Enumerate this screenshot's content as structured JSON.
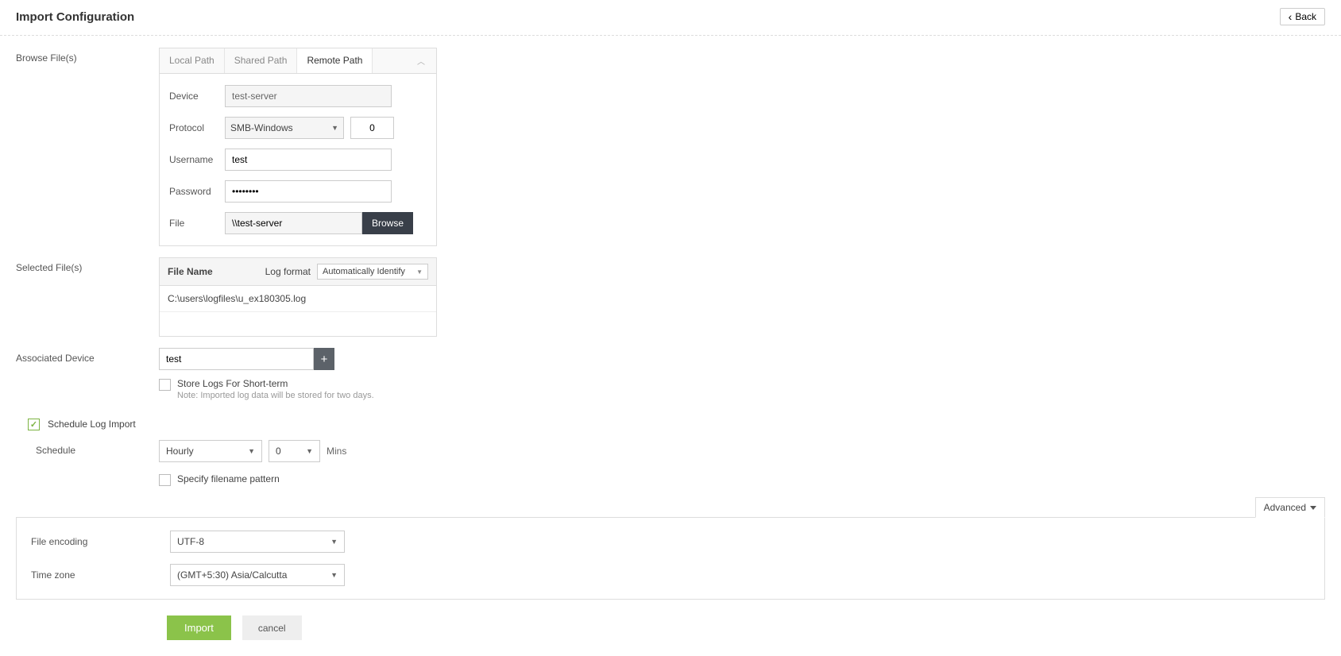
{
  "header": {
    "title": "Import Configuration",
    "back": "Back"
  },
  "labels": {
    "browseFiles": "Browse File(s)",
    "selectedFiles": "Selected File(s)",
    "associatedDevice": "Associated Device",
    "schedule": "Schedule",
    "fileEncoding": "File encoding",
    "timeZone": "Time zone"
  },
  "tabs": {
    "local": "Local Path",
    "shared": "Shared Path",
    "remote": "Remote Path"
  },
  "fields": {
    "device": {
      "label": "Device",
      "value": "test-server"
    },
    "protocol": {
      "label": "Protocol",
      "value": "SMB-Windows",
      "port": "0"
    },
    "username": {
      "label": "Username",
      "value": "test"
    },
    "password": {
      "label": "Password",
      "value": "••••••••"
    },
    "file": {
      "label": "File",
      "value": "\\\\test-server",
      "browse": "Browse"
    }
  },
  "selectedFiles": {
    "header": {
      "fileName": "File Name",
      "logFormat": "Log format",
      "formatValue": "Automatically Identify"
    },
    "files": [
      "C:\\users\\logfiles\\u_ex180305.log"
    ]
  },
  "associatedDevice": {
    "value": "test",
    "storeLogs": {
      "label": "Store Logs For Short-term",
      "note": "Note: Imported log data will be stored for two days."
    }
  },
  "scheduleLogImport": {
    "label": "Schedule Log Import",
    "checked": true,
    "frequency": "Hourly",
    "minutes": "0",
    "minsLabel": "Mins",
    "specifyPattern": "Specify filename pattern"
  },
  "advanced": {
    "label": "Advanced",
    "fileEncoding": "UTF-8",
    "timeZone": "(GMT+5:30) Asia/Calcutta"
  },
  "buttons": {
    "import": "Import",
    "cancel": "cancel"
  }
}
